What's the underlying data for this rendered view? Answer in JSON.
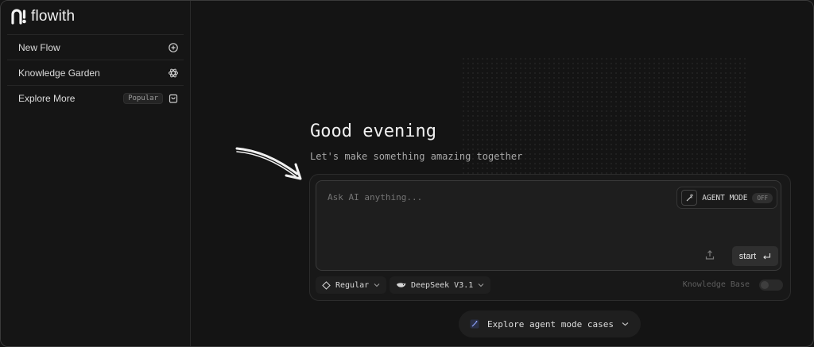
{
  "app": {
    "name": "flowith"
  },
  "sidebar": {
    "items": [
      {
        "label": "New Flow",
        "icon": "plus-circle-icon"
      },
      {
        "label": "Knowledge Garden",
        "icon": "atom-icon"
      },
      {
        "label": "Explore More",
        "badge": "Popular",
        "icon": "bag-icon"
      }
    ]
  },
  "main": {
    "greeting": "Good evening",
    "subtitle": "Let's make something amazing together",
    "composer": {
      "placeholder": "Ask AI anything...",
      "agent_mode_label": "AGENT MODE",
      "agent_mode_state": "OFF",
      "start_label": "start"
    },
    "options": {
      "mode": "Regular",
      "model": "DeepSeek V3.1",
      "knowledge_base_label": "Knowledge Base"
    },
    "explore_agent_label": "Explore agent mode cases"
  },
  "colors": {
    "background": "#141414",
    "surface": "#1e1e1e",
    "text": "#e6e6e6",
    "muted": "#8c8c8c"
  }
}
